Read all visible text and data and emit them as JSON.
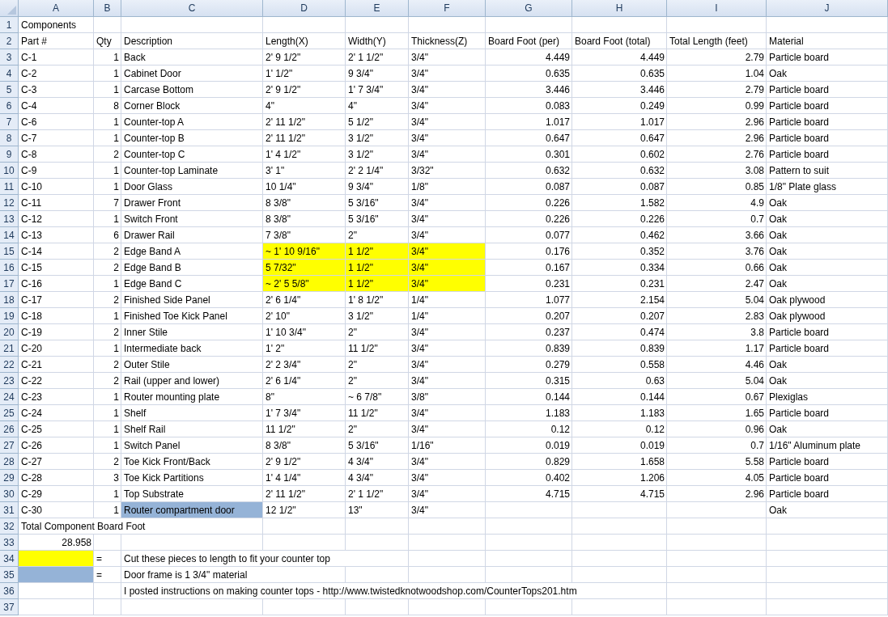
{
  "columns": [
    "A",
    "B",
    "C",
    "D",
    "E",
    "F",
    "G",
    "H",
    "I",
    "J"
  ],
  "rows": [
    {
      "number": "1",
      "cells": [
        {
          "kind": "text",
          "text": "Components"
        },
        {
          "kind": "blank"
        },
        {
          "kind": "blank"
        },
        {
          "kind": "blank"
        },
        {
          "kind": "blank"
        },
        {
          "kind": "blank"
        },
        {
          "kind": "blank"
        },
        {
          "kind": "blank"
        },
        {
          "kind": "blank"
        },
        {
          "kind": "blank"
        }
      ]
    },
    {
      "number": "2",
      "cells": [
        {
          "kind": "text",
          "text": "Part #"
        },
        {
          "kind": "text",
          "text": "Qty"
        },
        {
          "kind": "text",
          "text": "Description"
        },
        {
          "kind": "text",
          "text": "Length(X)"
        },
        {
          "kind": "text",
          "text": "Width(Y)"
        },
        {
          "kind": "text",
          "text": "Thickness(Z)"
        },
        {
          "kind": "text",
          "text": "Board Foot (per)"
        },
        {
          "kind": "text",
          "text": "Board Foot (total)"
        },
        {
          "kind": "text",
          "text": "Total Length (feet)"
        },
        {
          "kind": "text",
          "text": "Material"
        }
      ]
    },
    {
      "number": "3",
      "cells": [
        {
          "kind": "text",
          "text": "C-1"
        },
        {
          "kind": "number",
          "text": "1"
        },
        {
          "kind": "text",
          "text": "Back"
        },
        {
          "kind": "text",
          "text": "2' 9 1/2\""
        },
        {
          "kind": "text",
          "text": "2' 1 1/2\""
        },
        {
          "kind": "text",
          "text": "3/4\""
        },
        {
          "kind": "number",
          "text": "4.449"
        },
        {
          "kind": "number",
          "text": "4.449"
        },
        {
          "kind": "number",
          "text": "2.79"
        },
        {
          "kind": "text",
          "text": "Particle board"
        }
      ]
    },
    {
      "number": "4",
      "cells": [
        {
          "kind": "text",
          "text": "C-2"
        },
        {
          "kind": "number",
          "text": "1"
        },
        {
          "kind": "text",
          "text": "Cabinet Door"
        },
        {
          "kind": "text",
          "text": "1' 1/2\""
        },
        {
          "kind": "text",
          "text": "9 3/4\""
        },
        {
          "kind": "text",
          "text": "3/4\""
        },
        {
          "kind": "number",
          "text": "0.635"
        },
        {
          "kind": "number",
          "text": "0.635"
        },
        {
          "kind": "number",
          "text": "1.04"
        },
        {
          "kind": "text",
          "text": "Oak"
        }
      ]
    },
    {
      "number": "5",
      "cells": [
        {
          "kind": "text",
          "text": "C-3"
        },
        {
          "kind": "number",
          "text": "1"
        },
        {
          "kind": "text",
          "text": "Carcase Bottom"
        },
        {
          "kind": "text",
          "text": "2' 9 1/2\""
        },
        {
          "kind": "text",
          "text": "1' 7 3/4\""
        },
        {
          "kind": "text",
          "text": "3/4\""
        },
        {
          "kind": "number",
          "text": "3.446"
        },
        {
          "kind": "number",
          "text": "3.446"
        },
        {
          "kind": "number",
          "text": "2.79"
        },
        {
          "kind": "text",
          "text": "Particle board"
        }
      ]
    },
    {
      "number": "6",
      "cells": [
        {
          "kind": "text",
          "text": "C-4"
        },
        {
          "kind": "number",
          "text": "8"
        },
        {
          "kind": "text",
          "text": "Corner Block"
        },
        {
          "kind": "text",
          "text": "4\""
        },
        {
          "kind": "text",
          "text": "4\""
        },
        {
          "kind": "text",
          "text": "3/4\""
        },
        {
          "kind": "number",
          "text": "0.083"
        },
        {
          "kind": "number",
          "text": "0.249"
        },
        {
          "kind": "number",
          "text": "0.99"
        },
        {
          "kind": "text",
          "text": "Particle board"
        }
      ]
    },
    {
      "number": "7",
      "cells": [
        {
          "kind": "text",
          "text": "C-6"
        },
        {
          "kind": "number",
          "text": "1"
        },
        {
          "kind": "text",
          "text": "Counter-top A"
        },
        {
          "kind": "text",
          "text": "2' 11 1/2\""
        },
        {
          "kind": "text",
          "text": "5 1/2\""
        },
        {
          "kind": "text",
          "text": "3/4\""
        },
        {
          "kind": "number",
          "text": "1.017"
        },
        {
          "kind": "number",
          "text": "1.017"
        },
        {
          "kind": "number",
          "text": "2.96"
        },
        {
          "kind": "text",
          "text": "Particle board"
        }
      ]
    },
    {
      "number": "8",
      "cells": [
        {
          "kind": "text",
          "text": "C-7"
        },
        {
          "kind": "number",
          "text": "1"
        },
        {
          "kind": "text",
          "text": "Counter-top B"
        },
        {
          "kind": "text",
          "text": "2' 11 1/2\""
        },
        {
          "kind": "text",
          "text": "3 1/2\""
        },
        {
          "kind": "text",
          "text": "3/4\""
        },
        {
          "kind": "number",
          "text": "0.647"
        },
        {
          "kind": "number",
          "text": "0.647"
        },
        {
          "kind": "number",
          "text": "2.96"
        },
        {
          "kind": "text",
          "text": "Particle board"
        }
      ]
    },
    {
      "number": "9",
      "cells": [
        {
          "kind": "text",
          "text": "C-8"
        },
        {
          "kind": "number",
          "text": "2"
        },
        {
          "kind": "text",
          "text": "Counter-top C"
        },
        {
          "kind": "text",
          "text": "1' 4 1/2\""
        },
        {
          "kind": "text",
          "text": "3 1/2\""
        },
        {
          "kind": "text",
          "text": "3/4\""
        },
        {
          "kind": "number",
          "text": "0.301"
        },
        {
          "kind": "number",
          "text": "0.602"
        },
        {
          "kind": "number",
          "text": "2.76"
        },
        {
          "kind": "text",
          "text": "Particle board"
        }
      ]
    },
    {
      "number": "10",
      "cells": [
        {
          "kind": "text",
          "text": "C-9"
        },
        {
          "kind": "number",
          "text": "1"
        },
        {
          "kind": "text",
          "text": "Counter-top Laminate"
        },
        {
          "kind": "text",
          "text": "3' 1\""
        },
        {
          "kind": "text",
          "text": "2' 2 1/4\""
        },
        {
          "kind": "text",
          "text": "3/32\""
        },
        {
          "kind": "number",
          "text": "0.632"
        },
        {
          "kind": "number",
          "text": "0.632"
        },
        {
          "kind": "number",
          "text": "3.08"
        },
        {
          "kind": "text",
          "text": "Pattern to suit"
        }
      ]
    },
    {
      "number": "11",
      "cells": [
        {
          "kind": "text",
          "text": "C-10"
        },
        {
          "kind": "number",
          "text": "1"
        },
        {
          "kind": "text",
          "text": "Door Glass"
        },
        {
          "kind": "text",
          "text": "10 1/4\""
        },
        {
          "kind": "text",
          "text": "9 3/4\""
        },
        {
          "kind": "text",
          "text": "1/8\""
        },
        {
          "kind": "number",
          "text": "0.087"
        },
        {
          "kind": "number",
          "text": "0.087"
        },
        {
          "kind": "number",
          "text": "0.85"
        },
        {
          "kind": "text",
          "text": "1/8\" Plate glass"
        }
      ]
    },
    {
      "number": "12",
      "cells": [
        {
          "kind": "text",
          "text": "C-11"
        },
        {
          "kind": "number",
          "text": "7"
        },
        {
          "kind": "text",
          "text": "Drawer Front"
        },
        {
          "kind": "text",
          "text": "8 3/8\""
        },
        {
          "kind": "text",
          "text": "5 3/16\""
        },
        {
          "kind": "text",
          "text": "3/4\""
        },
        {
          "kind": "number",
          "text": "0.226"
        },
        {
          "kind": "number",
          "text": "1.582"
        },
        {
          "kind": "number",
          "text": "4.9"
        },
        {
          "kind": "text",
          "text": "Oak"
        }
      ]
    },
    {
      "number": "13",
      "cells": [
        {
          "kind": "text",
          "text": "C-12"
        },
        {
          "kind": "number",
          "text": "1"
        },
        {
          "kind": "text",
          "text": "Switch Front"
        },
        {
          "kind": "text",
          "text": "8 3/8\""
        },
        {
          "kind": "text",
          "text": "5 3/16\""
        },
        {
          "kind": "text",
          "text": "3/4\""
        },
        {
          "kind": "number",
          "text": "0.226"
        },
        {
          "kind": "number",
          "text": "0.226"
        },
        {
          "kind": "number",
          "text": "0.7"
        },
        {
          "kind": "text",
          "text": "Oak"
        }
      ]
    },
    {
      "number": "14",
      "cells": [
        {
          "kind": "text",
          "text": "C-13"
        },
        {
          "kind": "number",
          "text": "6"
        },
        {
          "kind": "text",
          "text": "Drawer Rail"
        },
        {
          "kind": "text",
          "text": "7 3/8\""
        },
        {
          "kind": "text",
          "text": "2\""
        },
        {
          "kind": "text",
          "text": "3/4\""
        },
        {
          "kind": "number",
          "text": "0.077"
        },
        {
          "kind": "number",
          "text": "0.462"
        },
        {
          "kind": "number",
          "text": "3.66"
        },
        {
          "kind": "text",
          "text": "Oak"
        }
      ]
    },
    {
      "number": "15",
      "cells": [
        {
          "kind": "text",
          "text": "C-14"
        },
        {
          "kind": "number",
          "text": "2"
        },
        {
          "kind": "text",
          "text": "Edge Band A"
        },
        {
          "kind": "text",
          "text": "~ 1' 10 9/16\"",
          "color": "#ffff00"
        },
        {
          "kind": "text",
          "text": "1 1/2\"",
          "color": "#ffff00"
        },
        {
          "kind": "text",
          "text": "3/4\"",
          "color": "#ffff00"
        },
        {
          "kind": "number",
          "text": "0.176"
        },
        {
          "kind": "number",
          "text": "0.352"
        },
        {
          "kind": "number",
          "text": "3.76"
        },
        {
          "kind": "text",
          "text": "Oak"
        }
      ]
    },
    {
      "number": "16",
      "cells": [
        {
          "kind": "text",
          "text": "C-15"
        },
        {
          "kind": "number",
          "text": "2"
        },
        {
          "kind": "text",
          "text": "Edge Band B"
        },
        {
          "kind": "text",
          "text": "5 7/32\"",
          "color": "#ffff00"
        },
        {
          "kind": "text",
          "text": "1 1/2\"",
          "color": "#ffff00"
        },
        {
          "kind": "text",
          "text": "3/4\"",
          "color": "#ffff00"
        },
        {
          "kind": "number",
          "text": "0.167"
        },
        {
          "kind": "number",
          "text": "0.334"
        },
        {
          "kind": "number",
          "text": "0.66"
        },
        {
          "kind": "text",
          "text": "Oak"
        }
      ]
    },
    {
      "number": "17",
      "cells": [
        {
          "kind": "text",
          "text": "C-16"
        },
        {
          "kind": "number",
          "text": "1"
        },
        {
          "kind": "text",
          "text": "Edge Band C"
        },
        {
          "kind": "text",
          "text": "~ 2' 5 5/8\"",
          "color": "#ffff00"
        },
        {
          "kind": "text",
          "text": "1 1/2\"",
          "color": "#ffff00"
        },
        {
          "kind": "text",
          "text": "3/4\"",
          "color": "#ffff00"
        },
        {
          "kind": "number",
          "text": "0.231"
        },
        {
          "kind": "number",
          "text": "0.231"
        },
        {
          "kind": "number",
          "text": "2.47"
        },
        {
          "kind": "text",
          "text": "Oak"
        }
      ]
    },
    {
      "number": "18",
      "cells": [
        {
          "kind": "text",
          "text": "C-17"
        },
        {
          "kind": "number",
          "text": "2"
        },
        {
          "kind": "text",
          "text": "Finished Side Panel"
        },
        {
          "kind": "text",
          "text": "2' 6 1/4\""
        },
        {
          "kind": "text",
          "text": "1' 8 1/2\""
        },
        {
          "kind": "text",
          "text": "1/4\""
        },
        {
          "kind": "number",
          "text": "1.077"
        },
        {
          "kind": "number",
          "text": "2.154"
        },
        {
          "kind": "number",
          "text": "5.04"
        },
        {
          "kind": "text",
          "text": "Oak plywood"
        }
      ]
    },
    {
      "number": "19",
      "cells": [
        {
          "kind": "text",
          "text": "C-18"
        },
        {
          "kind": "number",
          "text": "1"
        },
        {
          "kind": "text",
          "text": "Finished Toe Kick Panel"
        },
        {
          "kind": "text",
          "text": "2' 10\""
        },
        {
          "kind": "text",
          "text": "3 1/2\""
        },
        {
          "kind": "text",
          "text": "1/4\""
        },
        {
          "kind": "number",
          "text": "0.207"
        },
        {
          "kind": "number",
          "text": "0.207"
        },
        {
          "kind": "number",
          "text": "2.83"
        },
        {
          "kind": "text",
          "text": "Oak plywood"
        }
      ]
    },
    {
      "number": "20",
      "cells": [
        {
          "kind": "text",
          "text": "C-19"
        },
        {
          "kind": "number",
          "text": "2"
        },
        {
          "kind": "text",
          "text": "Inner Stile"
        },
        {
          "kind": "text",
          "text": "1' 10 3/4\""
        },
        {
          "kind": "text",
          "text": "2\""
        },
        {
          "kind": "text",
          "text": "3/4\""
        },
        {
          "kind": "number",
          "text": "0.237"
        },
        {
          "kind": "number",
          "text": "0.474"
        },
        {
          "kind": "number",
          "text": "3.8"
        },
        {
          "kind": "text",
          "text": "Particle board"
        }
      ]
    },
    {
      "number": "21",
      "cells": [
        {
          "kind": "text",
          "text": "C-20"
        },
        {
          "kind": "number",
          "text": "1"
        },
        {
          "kind": "text",
          "text": "Intermediate back"
        },
        {
          "kind": "text",
          "text": "1' 2\""
        },
        {
          "kind": "text",
          "text": "11 1/2\""
        },
        {
          "kind": "text",
          "text": "3/4\""
        },
        {
          "kind": "number",
          "text": "0.839"
        },
        {
          "kind": "number",
          "text": "0.839"
        },
        {
          "kind": "number",
          "text": "1.17"
        },
        {
          "kind": "text",
          "text": "Particle board"
        }
      ]
    },
    {
      "number": "22",
      "cells": [
        {
          "kind": "text",
          "text": "C-21"
        },
        {
          "kind": "number",
          "text": "2"
        },
        {
          "kind": "text",
          "text": "Outer Stile"
        },
        {
          "kind": "text",
          "text": "2' 2 3/4\""
        },
        {
          "kind": "text",
          "text": "2\""
        },
        {
          "kind": "text",
          "text": "3/4\""
        },
        {
          "kind": "number",
          "text": "0.279"
        },
        {
          "kind": "number",
          "text": "0.558"
        },
        {
          "kind": "number",
          "text": "4.46"
        },
        {
          "kind": "text",
          "text": "Oak"
        }
      ]
    },
    {
      "number": "23",
      "cells": [
        {
          "kind": "text",
          "text": "C-22"
        },
        {
          "kind": "number",
          "text": "2"
        },
        {
          "kind": "text",
          "text": "Rail (upper and lower)"
        },
        {
          "kind": "text",
          "text": "2' 6 1/4\""
        },
        {
          "kind": "text",
          "text": "2\""
        },
        {
          "kind": "text",
          "text": "3/4\""
        },
        {
          "kind": "number",
          "text": "0.315"
        },
        {
          "kind": "number",
          "text": "0.63"
        },
        {
          "kind": "number",
          "text": "5.04"
        },
        {
          "kind": "text",
          "text": "Oak"
        }
      ]
    },
    {
      "number": "24",
      "cells": [
        {
          "kind": "text",
          "text": "C-23"
        },
        {
          "kind": "number",
          "text": "1"
        },
        {
          "kind": "text",
          "text": "Router mounting plate"
        },
        {
          "kind": "text",
          "text": "8\""
        },
        {
          "kind": "text",
          "text": "~ 6 7/8\""
        },
        {
          "kind": "text",
          "text": "3/8\""
        },
        {
          "kind": "number",
          "text": "0.144"
        },
        {
          "kind": "number",
          "text": "0.144"
        },
        {
          "kind": "number",
          "text": "0.67"
        },
        {
          "kind": "text",
          "text": "Plexiglas"
        }
      ]
    },
    {
      "number": "25",
      "cells": [
        {
          "kind": "text",
          "text": "C-24"
        },
        {
          "kind": "number",
          "text": "1"
        },
        {
          "kind": "text",
          "text": "Shelf"
        },
        {
          "kind": "text",
          "text": "1' 7 3/4\""
        },
        {
          "kind": "text",
          "text": "11 1/2\""
        },
        {
          "kind": "text",
          "text": "3/4\""
        },
        {
          "kind": "number",
          "text": "1.183"
        },
        {
          "kind": "number",
          "text": "1.183"
        },
        {
          "kind": "number",
          "text": "1.65"
        },
        {
          "kind": "text",
          "text": "Particle board"
        }
      ]
    },
    {
      "number": "26",
      "cells": [
        {
          "kind": "text",
          "text": "C-25"
        },
        {
          "kind": "number",
          "text": "1"
        },
        {
          "kind": "text",
          "text": "Shelf Rail"
        },
        {
          "kind": "text",
          "text": "11 1/2\""
        },
        {
          "kind": "text",
          "text": "2\""
        },
        {
          "kind": "text",
          "text": "3/4\""
        },
        {
          "kind": "number",
          "text": "0.12"
        },
        {
          "kind": "number",
          "text": "0.12"
        },
        {
          "kind": "number",
          "text": "0.96"
        },
        {
          "kind": "text",
          "text": "Oak"
        }
      ]
    },
    {
      "number": "27",
      "cells": [
        {
          "kind": "text",
          "text": "C-26"
        },
        {
          "kind": "number",
          "text": "1"
        },
        {
          "kind": "text",
          "text": "Switch Panel"
        },
        {
          "kind": "text",
          "text": "8 3/8\""
        },
        {
          "kind": "text",
          "text": "5 3/16\""
        },
        {
          "kind": "text",
          "text": "1/16\""
        },
        {
          "kind": "number",
          "text": "0.019"
        },
        {
          "kind": "number",
          "text": "0.019"
        },
        {
          "kind": "number",
          "text": "0.7"
        },
        {
          "kind": "text",
          "text": "1/16\" Aluminum plate"
        }
      ]
    },
    {
      "number": "28",
      "cells": [
        {
          "kind": "text",
          "text": "C-27"
        },
        {
          "kind": "number",
          "text": "2"
        },
        {
          "kind": "text",
          "text": "Toe Kick Front/Back"
        },
        {
          "kind": "text",
          "text": "2' 9 1/2\""
        },
        {
          "kind": "text",
          "text": "4 3/4\""
        },
        {
          "kind": "text",
          "text": "3/4\""
        },
        {
          "kind": "number",
          "text": "0.829"
        },
        {
          "kind": "number",
          "text": "1.658"
        },
        {
          "kind": "number",
          "text": "5.58"
        },
        {
          "kind": "text",
          "text": "Particle board"
        }
      ]
    },
    {
      "number": "29",
      "cells": [
        {
          "kind": "text",
          "text": "C-28"
        },
        {
          "kind": "number",
          "text": "3"
        },
        {
          "kind": "text",
          "text": "Toe Kick Partitions"
        },
        {
          "kind": "text",
          "text": "1' 4 1/4\""
        },
        {
          "kind": "text",
          "text": "4 3/4\""
        },
        {
          "kind": "text",
          "text": "3/4\""
        },
        {
          "kind": "number",
          "text": "0.402"
        },
        {
          "kind": "number",
          "text": "1.206"
        },
        {
          "kind": "number",
          "text": "4.05"
        },
        {
          "kind": "text",
          "text": "Particle board"
        }
      ]
    },
    {
      "number": "30",
      "cells": [
        {
          "kind": "text",
          "text": "C-29"
        },
        {
          "kind": "number",
          "text": "1"
        },
        {
          "kind": "text",
          "text": "Top Substrate"
        },
        {
          "kind": "text",
          "text": "2' 11 1/2\""
        },
        {
          "kind": "text",
          "text": "2' 1 1/2\""
        },
        {
          "kind": "text",
          "text": "3/4\""
        },
        {
          "kind": "number",
          "text": "4.715"
        },
        {
          "kind": "number",
          "text": "4.715"
        },
        {
          "kind": "number",
          "text": "2.96"
        },
        {
          "kind": "text",
          "text": "Particle board"
        }
      ]
    },
    {
      "number": "31",
      "cells": [
        {
          "kind": "text",
          "text": "C-30"
        },
        {
          "kind": "number",
          "text": "1"
        },
        {
          "kind": "text",
          "text": "Router compartment door",
          "color": "#95b3d7"
        },
        {
          "kind": "text",
          "text": "12 1/2\""
        },
        {
          "kind": "text",
          "text": "13\""
        },
        {
          "kind": "text",
          "text": "3/4\""
        },
        {
          "kind": "blank"
        },
        {
          "kind": "blank"
        },
        {
          "kind": "blank"
        },
        {
          "kind": "text",
          "text": "Oak"
        }
      ]
    },
    {
      "number": "32",
      "cells": [
        {
          "kind": "text",
          "text": "Total Component Board Foot"
        },
        {
          "kind": "blank"
        },
        {
          "kind": "blank"
        },
        {
          "kind": "blank"
        },
        {
          "kind": "blank"
        },
        {
          "kind": "blank"
        },
        {
          "kind": "blank"
        },
        {
          "kind": "blank"
        },
        {
          "kind": "blank"
        },
        {
          "kind": "blank"
        }
      ]
    },
    {
      "number": "33",
      "cells": [
        {
          "kind": "number",
          "text": "28.958"
        },
        {
          "kind": "blank"
        },
        {
          "kind": "blank"
        },
        {
          "kind": "blank"
        },
        {
          "kind": "blank"
        },
        {
          "kind": "blank"
        },
        {
          "kind": "blank"
        },
        {
          "kind": "blank"
        },
        {
          "kind": "blank"
        },
        {
          "kind": "blank"
        }
      ]
    },
    {
      "number": "34",
      "cells": [
        {
          "kind": "fill",
          "color": "#ffff00"
        },
        {
          "kind": "text",
          "text": "="
        },
        {
          "kind": "text",
          "text": "Cut these pieces to length to fit your counter top"
        },
        {
          "kind": "blank"
        },
        {
          "kind": "blank"
        },
        {
          "kind": "blank"
        },
        {
          "kind": "blank"
        },
        {
          "kind": "blank"
        },
        {
          "kind": "blank"
        },
        {
          "kind": "blank"
        }
      ]
    },
    {
      "number": "35",
      "cells": [
        {
          "kind": "fill",
          "color": "#95b3d7"
        },
        {
          "kind": "text",
          "text": "="
        },
        {
          "kind": "text",
          "text": "Door frame is 1 3/4\" material"
        },
        {
          "kind": "blank"
        },
        {
          "kind": "blank"
        },
        {
          "kind": "blank"
        },
        {
          "kind": "blank"
        },
        {
          "kind": "blank"
        },
        {
          "kind": "blank"
        },
        {
          "kind": "blank"
        }
      ]
    },
    {
      "number": "36",
      "cells": [
        {
          "kind": "blank"
        },
        {
          "kind": "blank"
        },
        {
          "kind": "text",
          "text": "I posted instructions on making counter tops - http://www.twistedknotwoodshop.com/CounterTops201.htm"
        },
        {
          "kind": "blank"
        },
        {
          "kind": "blank"
        },
        {
          "kind": "blank"
        },
        {
          "kind": "blank"
        },
        {
          "kind": "blank"
        },
        {
          "kind": "blank"
        },
        {
          "kind": "blank"
        }
      ]
    },
    {
      "number": "37",
      "cells": [
        {
          "kind": "blank"
        },
        {
          "kind": "blank"
        },
        {
          "kind": "blank"
        },
        {
          "kind": "blank"
        },
        {
          "kind": "blank"
        },
        {
          "kind": "blank"
        },
        {
          "kind": "blank"
        },
        {
          "kind": "blank"
        },
        {
          "kind": "blank"
        },
        {
          "kind": "blank"
        }
      ]
    }
  ]
}
